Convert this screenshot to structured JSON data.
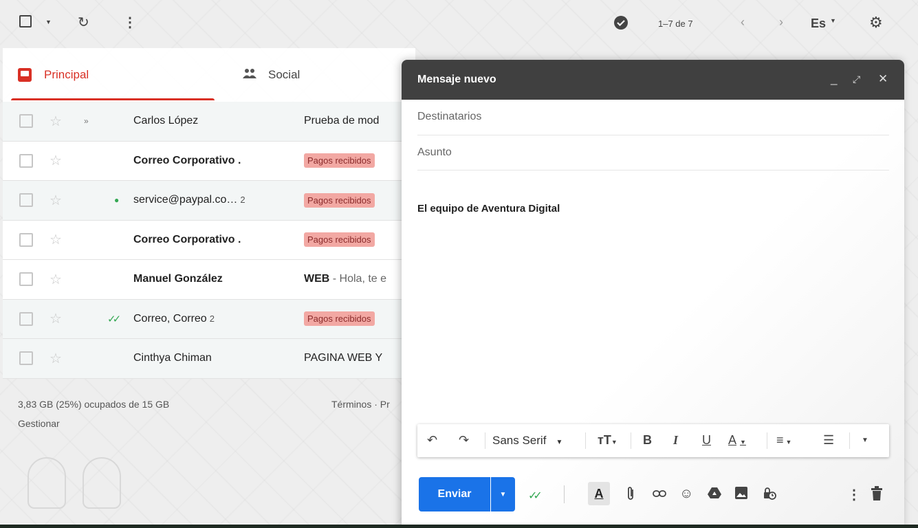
{
  "toolbar": {
    "pager": "1–7 de 7",
    "language": "Es"
  },
  "tabs": [
    {
      "label": "Principal"
    },
    {
      "label": "Social"
    }
  ],
  "emails": [
    {
      "sender": "Carlos López",
      "count": "",
      "subject": "Prueba de mod",
      "label": "",
      "read": true,
      "marker": "»"
    },
    {
      "sender": "Correo Corporativo .",
      "count": "",
      "subject": "",
      "label": "Pagos recibidos",
      "read": false,
      "marker": ""
    },
    {
      "sender": "service@paypal.co…",
      "count": "2",
      "subject": "",
      "label": "Pagos recibidos",
      "read": true,
      "marker": ""
    },
    {
      "sender": "Correo Corporativo .",
      "count": "",
      "subject": "",
      "label": "Pagos recibidos",
      "read": false,
      "marker": ""
    },
    {
      "sender": "Manuel González",
      "count": "",
      "subject": "WEB - Hola, te e",
      "label": "",
      "read": false,
      "marker": ""
    },
    {
      "sender": "Correo, Correo",
      "count": "2",
      "subject": "",
      "label": "Pagos recibidos",
      "read": true,
      "marker": ""
    },
    {
      "sender": "Cinthya Chiman",
      "count": "",
      "subject": "PAGINA WEB Y",
      "label": "",
      "read": true,
      "marker": ""
    }
  ],
  "footer": {
    "storage": "3,83 GB (25%) ocupados de 15 GB",
    "manage": "Gestionar",
    "terms": "Términos · Pr"
  },
  "compose": {
    "title": "Mensaje nuevo",
    "to_placeholder": "Destinatarios",
    "subject_placeholder": "Asunto",
    "body": "El equipo de Aventura Digital",
    "font": "Sans Serif",
    "send_label": "Enviar"
  },
  "colors": {
    "accent_red": "#d93025",
    "send_blue": "#1a73e8",
    "header_dark": "#404040",
    "label_chip": "#f2a8a3"
  }
}
